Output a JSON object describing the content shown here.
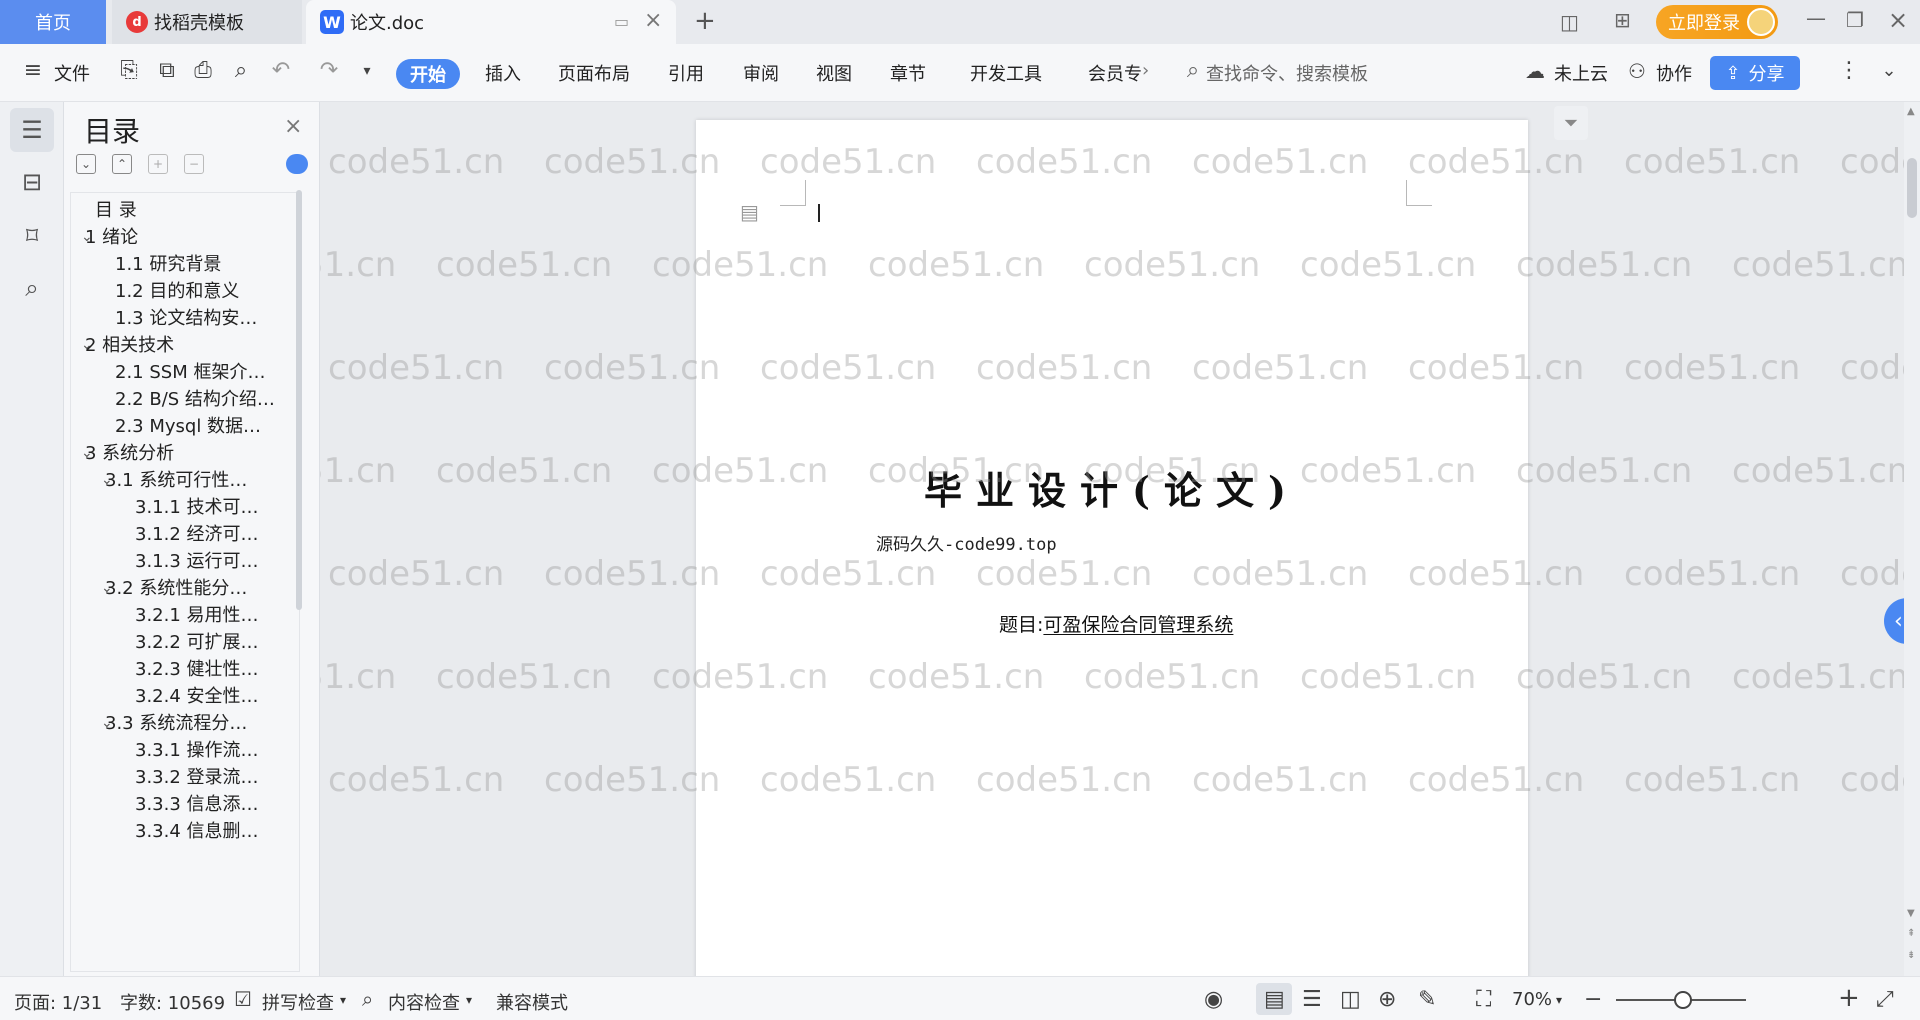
{
  "titlebar": {
    "home_tab": "首页",
    "template_tab": "找稻壳模板",
    "doc_tab": "论文.doc",
    "login_label": "立即登录"
  },
  "ribbon": {
    "menu_file": "文件",
    "tabs": [
      "开始",
      "插入",
      "页面布局",
      "引用",
      "审阅",
      "视图",
      "章节",
      "开发工具",
      "会员专"
    ],
    "search_placeholder": "查找命令、搜索模板",
    "cloud_label": "未上云",
    "collab_label": "协作",
    "share_label": "分享"
  },
  "toc": {
    "title": "目录",
    "items": [
      {
        "label": "目 录"
      },
      {
        "label": "1 绪论"
      },
      {
        "label": "1.1 研究背景"
      },
      {
        "label": "1.2 目的和意义"
      },
      {
        "label": "1.3 论文结构安…"
      },
      {
        "label": "2 相关技术"
      },
      {
        "label": "2.1 SSM 框架介…"
      },
      {
        "label": "2.2 B/S 结构介绍…"
      },
      {
        "label": "2.3 Mysql 数据…"
      },
      {
        "label": "3 系统分析"
      },
      {
        "label": "3.1 系统可行性…"
      },
      {
        "label": "3.1.1 技术可…"
      },
      {
        "label": "3.1.2 经济可…"
      },
      {
        "label": "3.1.3 运行可…"
      },
      {
        "label": "3.2 系统性能分…"
      },
      {
        "label": "3.2.1 易用性…"
      },
      {
        "label": "3.2.2 可扩展…"
      },
      {
        "label": "3.2.3 健壮性…"
      },
      {
        "label": "3.2.4 安全性…"
      },
      {
        "label": "3.3 系统流程分…"
      },
      {
        "label": "3.3.1 操作流…"
      },
      {
        "label": "3.3.2 登录流…"
      },
      {
        "label": "3.3.3 信息添…"
      },
      {
        "label": "3.3.4 信息删…"
      }
    ]
  },
  "document": {
    "title": "毕业设计(论文)",
    "source": "源码久久-code99.top",
    "topic_label": "题目:",
    "topic_value": "可盈保险合同管理系统"
  },
  "watermark": "code51.cn",
  "statusbar": {
    "page": "页面: 1/31",
    "words": "字数: 10569",
    "spellcheck": "拼写检查",
    "content_check": "内容检查",
    "compat_mode": "兼容模式",
    "zoom": "70%"
  },
  "colors": {
    "accent": "#4a88f2",
    "login": "#f39a12",
    "home_tab": "#5b8def"
  }
}
